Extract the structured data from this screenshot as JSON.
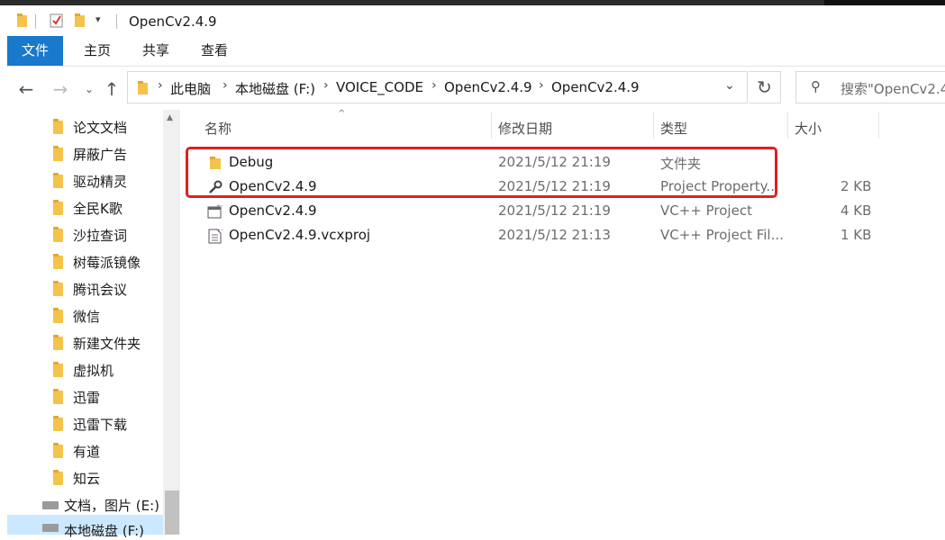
{
  "window": {
    "title": "OpenCv2.4.9"
  },
  "ribbon": {
    "tabs": [
      {
        "label": "文件"
      },
      {
        "label": "主页"
      },
      {
        "label": "共享"
      },
      {
        "label": "查看"
      }
    ]
  },
  "address": {
    "crumbs": [
      "此电脑",
      "本地磁盘 (F:)",
      "VOICE_CODE",
      "OpenCv2.4.9",
      "OpenCv2.4.9"
    ],
    "search_placeholder": "搜索\"OpenCv2.4"
  },
  "nav_pane": {
    "items": [
      {
        "label": "论文文档"
      },
      {
        "label": "屏蔽广告"
      },
      {
        "label": "驱动精灵"
      },
      {
        "label": "全民K歌"
      },
      {
        "label": "沙拉查词"
      },
      {
        "label": "树莓派镜像"
      },
      {
        "label": "腾讯会议"
      },
      {
        "label": "微信"
      },
      {
        "label": "新建文件夹"
      },
      {
        "label": "虚拟机"
      },
      {
        "label": "迅雷"
      },
      {
        "label": "迅雷下载"
      },
      {
        "label": "有道"
      },
      {
        "label": "知云"
      }
    ],
    "drives": [
      {
        "label": "文档，图片 (E:)"
      },
      {
        "label": "本地磁盘 (F:)"
      }
    ]
  },
  "columns": {
    "name": "名称",
    "date": "修改日期",
    "type": "类型",
    "size": "大小"
  },
  "files": [
    {
      "name": "Debug",
      "date": "2021/5/12 21:19",
      "type": "文件夹",
      "size": "",
      "icon": "folder-icon"
    },
    {
      "name": "OpenCv2.4.9",
      "date": "2021/5/12 21:19",
      "type": "Project Property...",
      "size": "2 KB",
      "icon": "wrench-icon"
    },
    {
      "name": "OpenCv2.4.9",
      "date": "2021/5/12 21:19",
      "type": "VC++ Project",
      "size": "4 KB",
      "icon": "vcproject-icon"
    },
    {
      "name": "OpenCv2.4.9.vcxproj",
      "date": "2021/5/12 21:13",
      "type": "VC++ Project Fil...",
      "size": "1 KB",
      "icon": "vcxproj-file-icon"
    }
  ],
  "colors": {
    "accent": "#1979ca",
    "highlight_box": "#e02020",
    "folder": "#f3c34b",
    "selection": "#cce8ff"
  }
}
